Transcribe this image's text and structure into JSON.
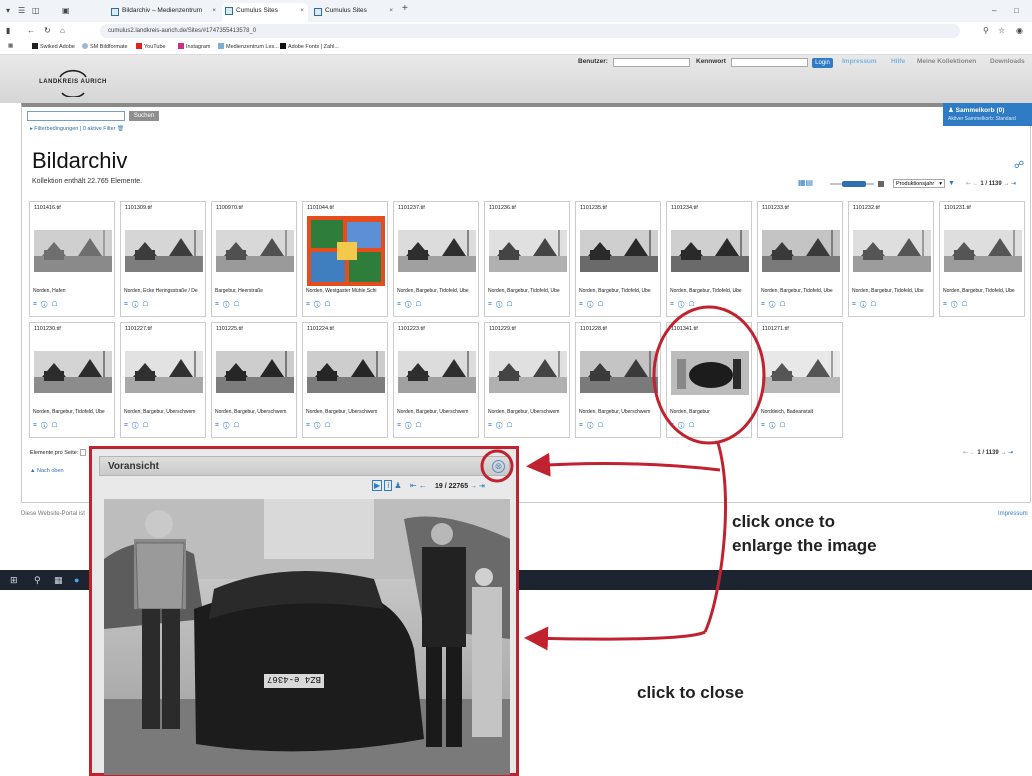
{
  "browser": {
    "tabs": [
      {
        "label": "Bildarchiv – Medienzentrum",
        "active": false
      },
      {
        "label": "Cumulus Sites",
        "active": true
      },
      {
        "label": "Cumulus Sites",
        "active": false
      }
    ],
    "new_tab_label": "+",
    "url": "cumulus2.landkreis-aurich.de/Sites/#1747355413578_0",
    "bookmarks": [
      "Swiked Adobe",
      "SM Bildformate",
      "YouTube",
      "Instagram",
      "Medienzentrum Les...",
      "Adobe Fonts | Zahl..."
    ]
  },
  "header": {
    "logo_text": "LANDKREIS AURICH",
    "user_label": "Benutzer:",
    "password_label": "Kennwort",
    "login_button": "Login",
    "links": [
      "Impressum",
      "Hilfe",
      "Meine Kollektionen",
      "Downloads"
    ]
  },
  "search": {
    "button_label": "Suchen",
    "filter_text": "Filterbedingungen | 0 aktive Filter"
  },
  "basket": {
    "title": "Sammelkorb (0)",
    "subtitle": "Aktiver Sammelkorb: Standard"
  },
  "main": {
    "title": "Bildarchiv",
    "collection_info": "Kollektion enthält 22.765 Elemente.",
    "sort_select": "Produktionsjahr",
    "pager_text": "1 / 1139",
    "per_page_label": "Elemente pro Seite:",
    "back_to_top": "Nach oben"
  },
  "thumbnails": [
    {
      "id": "1101416.tif",
      "caption": "Norden, Hafen",
      "tone": "harbor"
    },
    {
      "id": "1101309.tif",
      "caption": "Norden, Ecke Heringsstraße / De",
      "tone": "street"
    },
    {
      "id": "1100970.tif",
      "caption": "Bargebur, Heerstraße",
      "tone": "houses"
    },
    {
      "id": "1101044.tif",
      "caption": "Norden, Westgaster Mühle,Schi",
      "tone": "postcard"
    },
    {
      "id": "1101237.tif",
      "caption": "Norden, Bargebur, Tidofeld, Ube",
      "tone": "house"
    },
    {
      "id": "1101236.tif",
      "caption": "Norden, Bargebur, Tidofeld, Ube",
      "tone": "house2"
    },
    {
      "id": "1101235.tif",
      "caption": "Norden, Bargebur, Tidofeld, Ube",
      "tone": "trees"
    },
    {
      "id": "1101234.tif",
      "caption": "Norden, Bargebur, Tidofeld, Ube",
      "tone": "trees"
    },
    {
      "id": "1101233.tif",
      "caption": "Norden, Bargebur, Tidofeld, Ube",
      "tone": "trees2"
    },
    {
      "id": "1101232.tif",
      "caption": "Norden, Bargebur, Tidofeld, Ube",
      "tone": "marsh"
    },
    {
      "id": "1101231.tif",
      "caption": "Norden, Bargebur, Tidofeld, Ube",
      "tone": "marsh"
    },
    {
      "id": "1101230.tif",
      "caption": "Norden, Bargebur, Tidofeld, Ube",
      "tone": "water"
    },
    {
      "id": "1101227.tif",
      "caption": "Norden, Bargebur, Uberschwem",
      "tone": "water2"
    },
    {
      "id": "1101225.tif",
      "caption": "Norden, Bargebur, Uberschwem",
      "tone": "flood"
    },
    {
      "id": "1101224.tif",
      "caption": "Norden, Bargebur, Uberschwem",
      "tone": "flood"
    },
    {
      "id": "1101223.tif",
      "caption": "Norden, Bargebur, Uberschwem",
      "tone": "house"
    },
    {
      "id": "1101229.tif",
      "caption": "Norden, Bargebur, Uberschwem",
      "tone": "house2"
    },
    {
      "id": "1101228.tif",
      "caption": "Norden, Bargebur, Uberschwem",
      "tone": "trees2"
    },
    {
      "id": "1101341.tif",
      "caption": "Norden, Bargebur",
      "tone": "car"
    },
    {
      "id": "1101271.tif",
      "caption": "Norddeich, Badeanstalt",
      "tone": "beach"
    }
  ],
  "thumbnail_icons": "⌗ ⓘ ☖",
  "preview": {
    "title": "Voransicht",
    "counter": "19 / 22765",
    "license_plate": "BZ4 e-4367"
  },
  "footer": {
    "text": "Diese Website-Portal ist",
    "impressum": "Impressum"
  },
  "annotations": {
    "enlarge_line1": "click once to",
    "enlarge_line2": "enlarge the image",
    "close": "click to close",
    "accent_color": "#c0232f"
  }
}
